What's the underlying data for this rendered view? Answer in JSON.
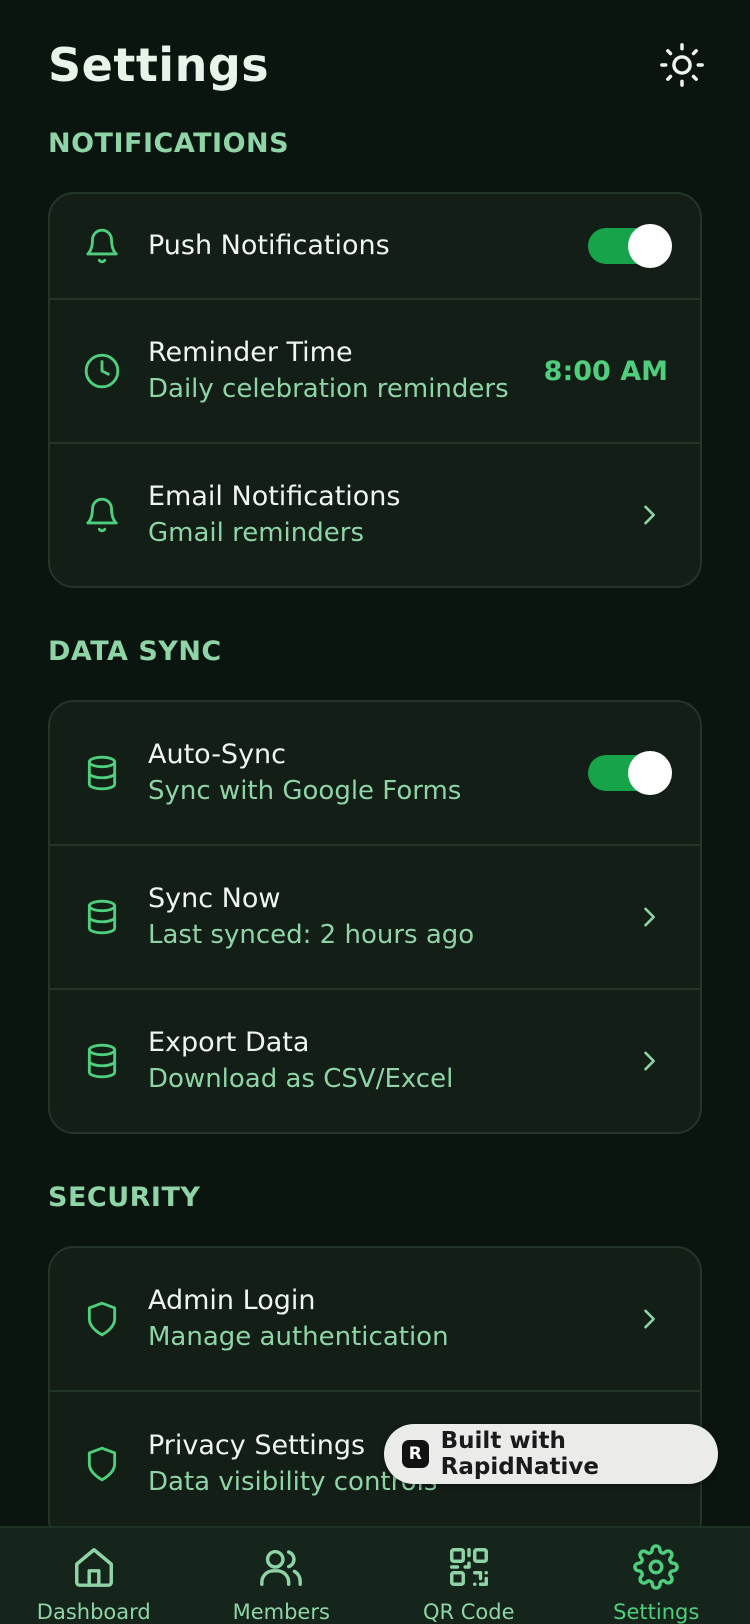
{
  "header": {
    "title": "Settings",
    "theme_icon": "sun-icon"
  },
  "sections": {
    "notifications": {
      "title": "NOTIFICATIONS",
      "rows": [
        {
          "label": "Push Notifications",
          "icon": "bell-icon",
          "control": "toggle",
          "enabled": true
        },
        {
          "label": "Reminder Time",
          "sub": "Daily celebration reminders",
          "icon": "clock-icon",
          "value": "8:00 AM"
        },
        {
          "label": "Email Notifications",
          "sub": "Gmail reminders",
          "icon": "bell-icon",
          "control": "chevron"
        }
      ]
    },
    "data_sync": {
      "title": "DATA SYNC",
      "rows": [
        {
          "label": "Auto-Sync",
          "sub": "Sync with Google Forms",
          "icon": "database-icon",
          "control": "toggle",
          "enabled": true
        },
        {
          "label": "Sync Now",
          "sub": "Last synced: 2 hours ago",
          "icon": "database-icon",
          "control": "chevron"
        },
        {
          "label": "Export Data",
          "sub": "Download as CSV/Excel",
          "icon": "database-icon",
          "control": "chevron"
        }
      ]
    },
    "security": {
      "title": "SECURITY",
      "rows": [
        {
          "label": "Admin Login",
          "sub": "Manage authentication",
          "icon": "shield-icon",
          "control": "chevron"
        },
        {
          "label": "Privacy Settings",
          "sub": "Data visibility controls",
          "icon": "shield-icon"
        }
      ]
    }
  },
  "badge": {
    "text": "Built with RapidNative",
    "logo": "R"
  },
  "tabbar": {
    "active": "Settings",
    "tabs": [
      {
        "label": "Dashboard",
        "icon": "home-icon"
      },
      {
        "label": "Members",
        "icon": "users-icon"
      },
      {
        "label": "QR Code",
        "icon": "qr-code-icon"
      },
      {
        "label": "Settings",
        "icon": "gear-icon"
      }
    ]
  },
  "colors": {
    "background": "#0b150f",
    "card": "#131e17",
    "accent": "#4fcf7d",
    "toggle_on": "#16a34a",
    "muted_text": "#8fd4a6"
  }
}
